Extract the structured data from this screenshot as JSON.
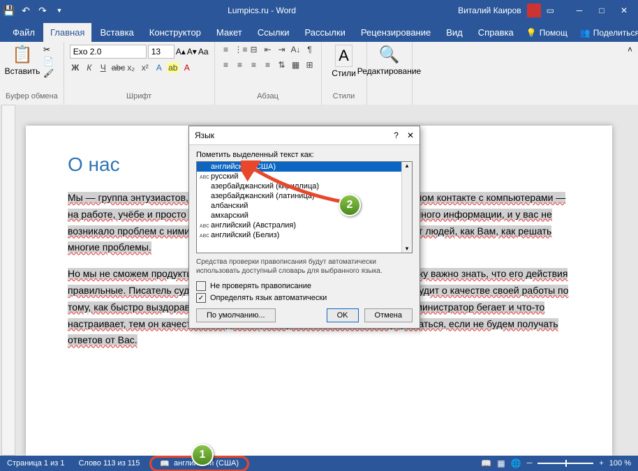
{
  "titlebar": {
    "title": "Lumpics.ru - Word",
    "user": "Виталий Каиров"
  },
  "tabs": {
    "file": "Файл",
    "home": "Главная",
    "insert": "Вставка",
    "design": "Конструктор",
    "layout": "Макет",
    "references": "Ссылки",
    "mailings": "Рассылки",
    "review": "Рецензирование",
    "view": "Вид",
    "help": "Справка",
    "tellme": "Помощ",
    "share": "Поделиться"
  },
  "ribbon": {
    "clipboard": {
      "label": "Буфер обмена",
      "paste": "Вставить"
    },
    "font": {
      "label": "Шрифт",
      "name": "Exo 2.0",
      "size": "13"
    },
    "paragraph": {
      "label": "Абзац"
    },
    "styles": {
      "label": "Стили",
      "btn": "Стили"
    },
    "editing": {
      "label": "Редактирование"
    }
  },
  "document": {
    "heading": "О нас",
    "p1": "Мы — группа энтузиастов, которые разбираются с компьютерами в ежедневном контакте с компьютерами — на работе, учёбе и просто дома. Мы знаем, что в интернете уже есть очень много информации, и у вас не возникало проблем с ними. Но это не так. Ежедневно мы получаем письма от людей, как Вам, как решать многие проблемы.",
    "p2": "Но мы не сможем продуктивно работать без Вашей помощи. Любому человеку важно знать, что его действия правильные. Писатель судит о своей работе по отзывам читателей. Доктор судит о качестве своей работы по тому, как быстро выздоравливают его пациенты. Чем меньше системный администратор бегает и что-то настраивает, тем он качественнее делает работу. Так и мы не сможем улучшаться, если не будем получать ответов от Вас."
  },
  "dialog": {
    "title": "Язык",
    "mark_as": "Пометить выделенный текст как:",
    "items": [
      {
        "spell": true,
        "label": "английский (США)",
        "selected": true
      },
      {
        "spell": true,
        "label": "русский"
      },
      {
        "spell": false,
        "label": "азербайджанский (кириллица)"
      },
      {
        "spell": false,
        "label": "азербайджанский (латиница)"
      },
      {
        "spell": false,
        "label": "албанский"
      },
      {
        "spell": false,
        "label": "амхарский"
      },
      {
        "spell": true,
        "label": "английский (Австралия)"
      },
      {
        "spell": true,
        "label": "английский (Белиз)"
      }
    ],
    "info": "Средства проверки правописания будут автоматически использовать доступный словарь для выбранного языка.",
    "no_check": "Не проверять правописание",
    "auto_detect": "Определять язык автоматически",
    "default": "По умолчанию...",
    "ok": "OK",
    "cancel": "Отмена"
  },
  "statusbar": {
    "page": "Страница 1 из 1",
    "words": "Слово 113 из 115",
    "lang": "английский (США)",
    "zoom": "100 %"
  },
  "callouts": {
    "one": "1",
    "two": "2"
  }
}
